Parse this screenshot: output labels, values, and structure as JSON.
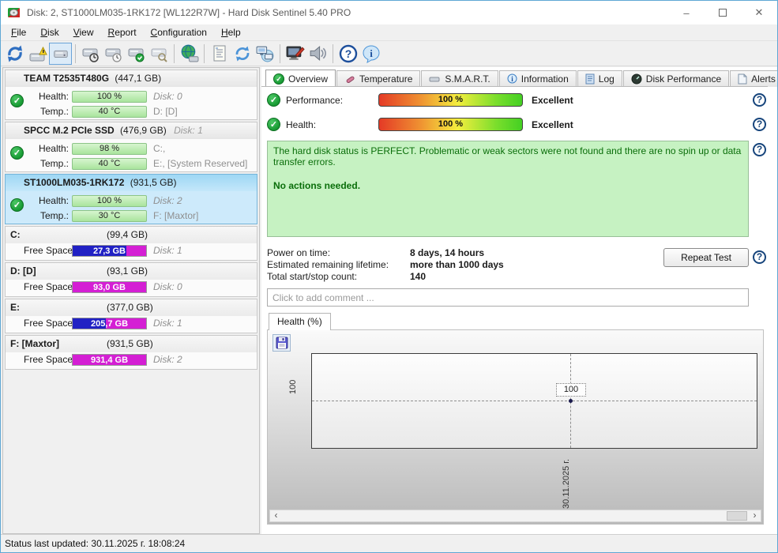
{
  "window": {
    "title": "Disk: 2, ST1000LM035-1RK172 [WL122R7W]  -  Hard Disk Sentinel 5.40 PRO",
    "controls": {
      "minimize": "–",
      "close": "✕"
    }
  },
  "menu": {
    "items": [
      "File",
      "Disk",
      "View",
      "Report",
      "Configuration",
      "Help"
    ]
  },
  "toolbar": {
    "icons": [
      "refresh-icon",
      "disk-alert-icon",
      "disk-overview-icon",
      "disk-stopwatch-icon",
      "disk-clock-icon",
      "disk-check-icon",
      "disk-search-icon",
      "network-globe-icon",
      "report-icon",
      "sync-icon",
      "network-computers-icon",
      "monitor-edit-icon",
      "speaker-icon",
      "help-icon",
      "info-icon"
    ]
  },
  "sidebar": {
    "disks": [
      {
        "name": "TEAM T2535T480G",
        "size": "(447,1 GB)",
        "suffix": "",
        "health_label": "Health:",
        "health": "100 %",
        "health_right": "Disk: 0",
        "temp_label": "Temp.:",
        "temp": "40 °C",
        "temp_right": "D: [D]"
      },
      {
        "name": "SPCC M.2 PCIe SSD",
        "size": "(476,9 GB)",
        "suffix": "Disk: 1",
        "health_label": "Health:",
        "health": "98 %",
        "health_right": "C:,",
        "temp_label": "Temp.:",
        "temp": "40 °C",
        "temp_right": "E:, [System Reserved]"
      },
      {
        "name": "ST1000LM035-1RK172",
        "size": "(931,5 GB)",
        "suffix": "",
        "health_label": "Health:",
        "health": "100 %",
        "health_right": "Disk: 2",
        "temp_label": "Temp.:",
        "temp": "30 °C",
        "temp_right": "F: [Maxtor]"
      }
    ],
    "partitions": [
      {
        "name": "C:",
        "size": "(99,4 GB)",
        "free_label": "Free Space",
        "free": "27,3 GB",
        "free_pct": 27,
        "right": "Disk: 1"
      },
      {
        "name": "D: [D]",
        "size": "(93,1 GB)",
        "free_label": "Free Space",
        "free": "93,0 GB",
        "free_pct": 100,
        "right": "Disk: 0"
      },
      {
        "name": "E:",
        "size": "(377,0 GB)",
        "free_label": "Free Space",
        "free": "205,7 GB",
        "free_pct": 55,
        "right": "Disk: 1"
      },
      {
        "name": "F: [Maxtor]",
        "size": "(931,5 GB)",
        "free_label": "Free Space",
        "free": "931,4 GB",
        "free_pct": 100,
        "right": "Disk: 2"
      }
    ]
  },
  "tabs": [
    {
      "label": "Overview"
    },
    {
      "label": "Temperature"
    },
    {
      "label": "S.M.A.R.T."
    },
    {
      "label": "Information"
    },
    {
      "label": "Log"
    },
    {
      "label": "Disk Performance"
    },
    {
      "label": "Alerts"
    }
  ],
  "overview": {
    "performance_label": "Performance:",
    "performance_value": "100 %",
    "performance_rating": "Excellent",
    "health_label": "Health:",
    "health_value": "100 %",
    "health_rating": "Excellent",
    "status_text_1": "The hard disk status is PERFECT. Problematic or weak sectors were not found and there are no spin up or data transfer errors.",
    "status_text_2": "No actions needed.",
    "info_rows": [
      {
        "label": "Power on time:",
        "value": "8 days, 14 hours"
      },
      {
        "label": "Estimated remaining lifetime:",
        "value": "more than 1000 days"
      },
      {
        "label": "Total start/stop count:",
        "value": "140"
      }
    ],
    "repeat_test_label": "Repeat Test",
    "comment_placeholder": "Click to add comment ..."
  },
  "chart_data": {
    "type": "line",
    "title": "Health (%)",
    "tab_label": "Health (%)",
    "x_labels": [
      "30.11.2025 г."
    ],
    "values": [
      100
    ],
    "y_tick": "100",
    "point_label": "100",
    "scroll_left": "‹",
    "scroll_right": "›"
  },
  "statusbar": {
    "text": "Status last updated: 30.11.2025 г. 18:08:24"
  },
  "colors": {
    "health_green": "#a9e49d",
    "free_blue": "#2121c4",
    "free_magenta": "#d41fd4",
    "status_bg": "#c6f2c2",
    "selected_bg": "#cdeafb",
    "accent_border": "#5fa8d5"
  }
}
